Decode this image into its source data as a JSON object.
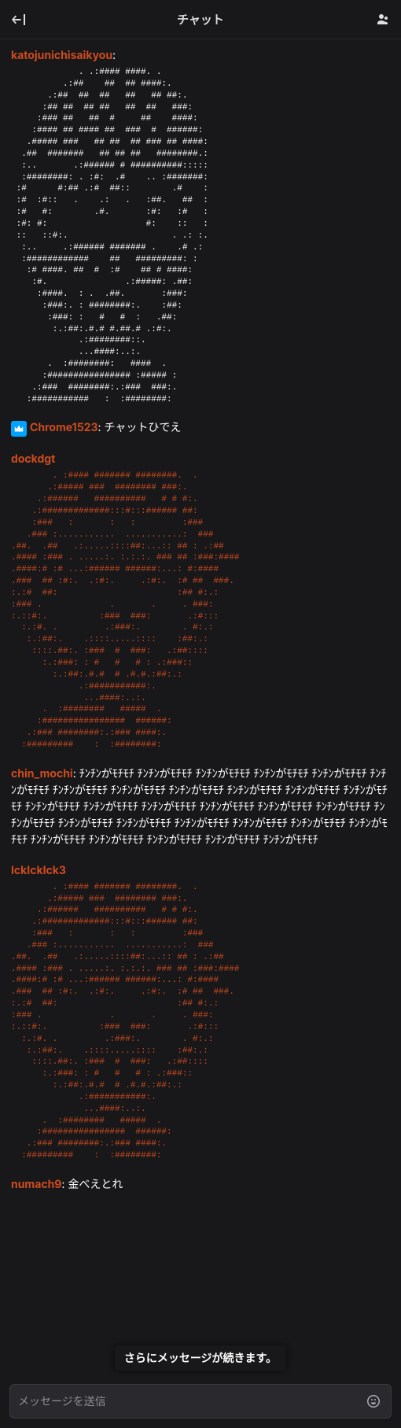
{
  "header": {
    "title": "チャット"
  },
  "messages": [
    {
      "user": "katojunichisaikyou",
      "user_color": "orange",
      "ascii_white": "             . .:#### ####. .\n          .:##    ##  ## ####:.\n       .:##  ##  ##   ##   ## ##:.\n      :## ##  ## ##   ##  ##   ###:\n     :### ##   ##  #     ##    ####:\n    :#### ## #### ##  ###  #  ######:\n   .##### ###   ## ##  ## ### ## ####:\n  .##  #######   ## ## ##   ########.:\n  :..       .:###### # ##########:::::\n  :########: . :#:  .#    .. :#######:\n :#      #:## .:#  ##::        .#    :\n :#  :#::   .    .:   .   :##.   ##  :\n :#   #:        .#.       :#:   :#   :\n :#: #:                   #:    ::   :\n ::   ::#:.                    . .: :.\n  :..     .:###### ####### .    .# .:\n  :############    ##   #########: :\n   :# ####. ##  #  :#    ## # ####:\n    :#.               .:#####: .##:\n     :####.  : .  .##.       :###:\n      :###:. : ########:.    :##:\n       :###: :   #   #  :   .##:\n        :.:##:.#.# #.##.# .:#:.\n             .:########::.\n             ...####:..:.\n       .  :########:   ####  .\n      :################ :##### :\n    .:###  ########:.:###  ###:.\n   :###########   :  :########:"
    },
    {
      "user": "Chrome1523",
      "user_color": "orange",
      "badge": "crown",
      "text": "チャットひでえ"
    },
    {
      "user": "dockdgt",
      "user_color": "orange",
      "ascii_orange": "        . :#### ####### ########.  .\n       .:##### ###  ######## ###:.\n     .:######   ##########   # # #:.\n    .:#############:::#:::###### ##:\n    :###   :       :   :         :###\n   .### :...........  ...........:  ###\n.##.  .##   .:.....::::##:...:: ## : .:##\n.#### :### . .....:. :.:.:. ### ## :###:####\n.####:# :# ...:###### ######:...: #:####\n.###  ## :#:.  .:#:.     .:#:.  :# ##  ###.\n:.:#  ##:                       :## #:.:\n:### .             .       .     . ###:\n:.::#:.          :###  ###:       .:#:::\n  :.:#. .         .:###:.        . #:.:\n   :.:##:.    .::::.....::::    :##:.:\n    ::::.##:. :###  #  ###:   .:##::::\n      :.:###: : #   #   # : .:###::\n        :.:##:.#.#  # .#.#.:##:.:\n             .:###########:.\n              ...####:..:.\n      .  :########   #####  .\n     :################  ######:\n   .:### ########:.:### ####:.\n  :#########    :  :########:"
    },
    {
      "user": "chin_mochi",
      "user_color": "orange",
      "text": "ﾁﾝﾁﾝがﾓﾁﾓﾁ ﾁﾝﾁﾝがﾓﾁﾓﾁ ﾁﾝﾁﾝがﾓﾁﾓﾁ ﾁﾝﾁﾝがﾓﾁﾓﾁ ﾁﾝﾁﾝがﾓﾁﾓﾁ ﾁﾝﾁﾝがﾓﾁﾓﾁ ﾁﾝﾁﾝがﾓﾁﾓﾁ ﾁﾝﾁﾝがﾓﾁﾓﾁ ﾁﾝﾁﾝがﾓﾁﾓﾁ ﾁﾝﾁﾝがﾓﾁﾓﾁ ﾁﾝﾁﾝがﾓﾁﾓﾁ ﾁﾝﾁﾝがﾓﾁﾓﾁ ﾁﾝﾁﾝがﾓﾁﾓﾁ ﾁﾝﾁﾝがﾓﾁﾓﾁ ﾁﾝﾁﾝがﾓﾁﾓﾁ ﾁﾝﾁﾝがﾓﾁﾓﾁ ﾁﾝﾁﾝがﾓﾁﾓﾁ ﾁﾝﾁﾝがﾓﾁﾓﾁ ﾁﾝﾁﾝがﾓﾁﾓﾁ ﾁﾝﾁﾝがﾓﾁﾓﾁ ﾁﾝﾁﾝがﾓﾁﾓﾁ ﾁﾝﾁﾝがﾓﾁﾓﾁ ﾁﾝﾁﾝがﾓﾁﾓﾁ ﾁﾝﾁﾝがﾓﾁﾓﾁ ﾁﾝﾁﾝがﾓﾁﾓﾁ ﾁﾝﾁﾝがﾓﾁﾓﾁ ﾁﾝﾁﾝがﾓﾁﾓﾁ ﾁﾝﾁﾝがﾓﾁﾓﾁ ﾁﾝﾁﾝがﾓﾁﾓﾁ ﾁﾝﾁﾝがﾓﾁﾓﾁ"
    },
    {
      "user": "IckIckIck3",
      "user_color": "orange",
      "ascii_orange": "        . :#### ####### ########.  .\n       .:##### ###  ######## ###:.\n     .:######   ##########   # # #:.\n    .:#############:::#:::###### ##:\n    :###   :       :   :         :###\n   .### :...........  ...........:  ###\n.##.  .##   .:.....::::##:...:: ## : .:##\n.#### :### . .....:. :.:.:. ### ## :###:####\n.####:# :# ...:###### ######:...: #:####\n.###  ## :#:.  .:#:.     .:#:.  :# ##  ###.\n:.:#  ##:                       :## #:.:\n:### .             .       .     . ###:\n:.::#:.          :###  ###:       .:#:::\n  :.:#. .         .:###:.        . #:.:\n   :.:##:.    .::::.....::::    :##:.:\n    ::::.##:. :###  #  ###:   .:##::::\n      :.:###: : #   #   # : .:###::\n        :.:##:.#.#  # .#.#.:##:.:\n             .:###########:.\n              ...####:..:.\n      .  :########   #####  .\n     :################  ######:\n   .:### ########:.:### ####:.\n  :#########    :  :########:"
    },
    {
      "user": "numach9",
      "user_color": "orange",
      "text": "金べえとれ"
    }
  ],
  "toast": "さらにメッセージが続きます。",
  "input": {
    "placeholder": "メッセージを送信"
  }
}
